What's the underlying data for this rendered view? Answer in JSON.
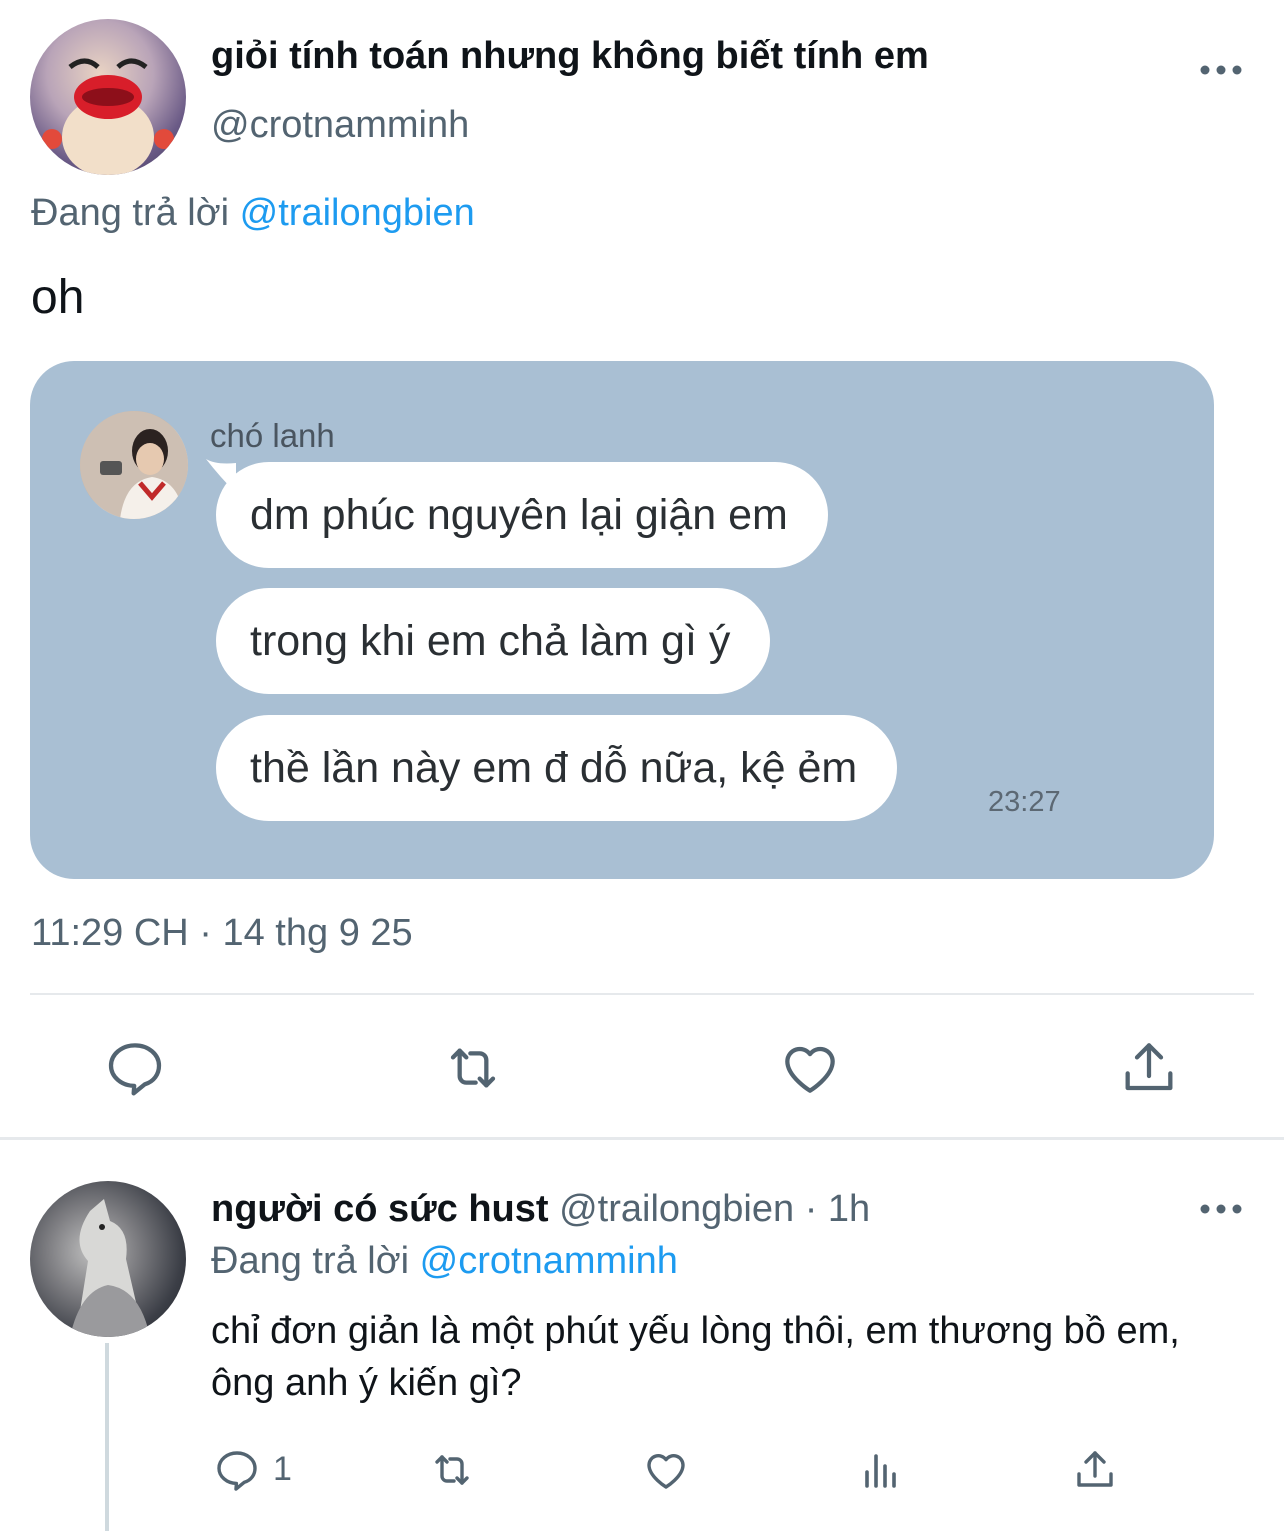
{
  "main_tweet": {
    "display_name": "giỏi tính toán nhưng không biết tính em",
    "handle": "@crotnamminh",
    "replying_prefix": "Đang trả lời",
    "replying_to": "@trailongbien",
    "text": "oh",
    "datetime": "11:29 CH · 14 thg 9 25"
  },
  "media": {
    "sender": "chó lanh",
    "messages": [
      "dm phúc nguyên lại giận em",
      "trong khi em chả làm gì ý",
      "thề lần này em đ dỗ nữa, kệ ẻm"
    ],
    "time": "23:27",
    "background": "#a9bfd3"
  },
  "actions": [
    "reply-icon",
    "retweet-icon",
    "like-icon",
    "share-icon"
  ],
  "reply_tweet": {
    "display_name": "người có sức hust",
    "meta": "@trailongbien · 1h",
    "replying_prefix": "Đang trả lời",
    "replying_to": "@crotnamminh",
    "text": "chỉ đơn giản là một phút yếu lòng thôi, em thương bồ em, ông anh ý kiến gì?",
    "reply_count": "1",
    "actions": [
      "reply-icon",
      "retweet-icon",
      "like-icon",
      "analytics-icon",
      "share-icon"
    ]
  },
  "colors": {
    "accent": "#1d9bf0",
    "secondary_text": "#536471",
    "primary_text": "#0f1419"
  }
}
